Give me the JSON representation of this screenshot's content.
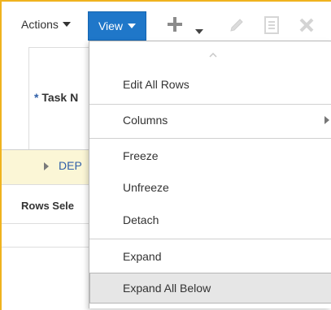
{
  "toolbar": {
    "actions_label": "Actions",
    "view_label": "View",
    "icons": [
      "caret-down-icon",
      "plus-icon",
      "pencil-icon",
      "document-icon",
      "close-icon"
    ],
    "accent_color": "#1f77c9",
    "frame_color": "#f0b31e"
  },
  "table": {
    "header": {
      "required_marker": "*",
      "task_label": "Task N"
    },
    "row": {
      "text": "DEP"
    },
    "status": {
      "rows_selected_label": "Rows Sele"
    },
    "highlight_color": "#fbf6d6"
  },
  "view_menu": {
    "items": [
      {
        "label": "Edit All Rows"
      },
      {
        "label": "Columns",
        "has_submenu": true
      },
      {
        "label": "Freeze"
      },
      {
        "label": "Unfreeze"
      },
      {
        "label": "Detach"
      },
      {
        "label": "Expand"
      },
      {
        "label": "Expand All Below",
        "hovered": true
      }
    ]
  }
}
